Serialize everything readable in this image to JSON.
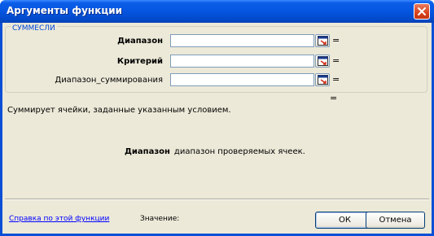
{
  "window": {
    "title": "Аргументы функции"
  },
  "function": {
    "name": "СУММЕСЛИ",
    "arguments": [
      {
        "label": "Диапазон",
        "value": "",
        "bold": true
      },
      {
        "label": "Критерий",
        "value": "",
        "bold": true
      },
      {
        "label": "Диапазон_суммирования",
        "value": "",
        "bold": false
      }
    ],
    "equals_sign": "=",
    "description": "Суммирует ячейки, заданные указанным условием.",
    "argument_help": {
      "name": "Диапазон",
      "text": "диапазон проверяемых ячеек."
    }
  },
  "footer": {
    "help_link": "Справка по этой функции",
    "value_label": "Значение:",
    "ok_label": "ОК",
    "cancel_label": "Отмена"
  },
  "colors": {
    "titlebar": "#0555e0",
    "dialog_bg": "#ece9d8",
    "group_label": "#0046d5",
    "link": "#0000ff"
  },
  "icons": {
    "close": "close-icon",
    "ref": "range-select-icon"
  }
}
